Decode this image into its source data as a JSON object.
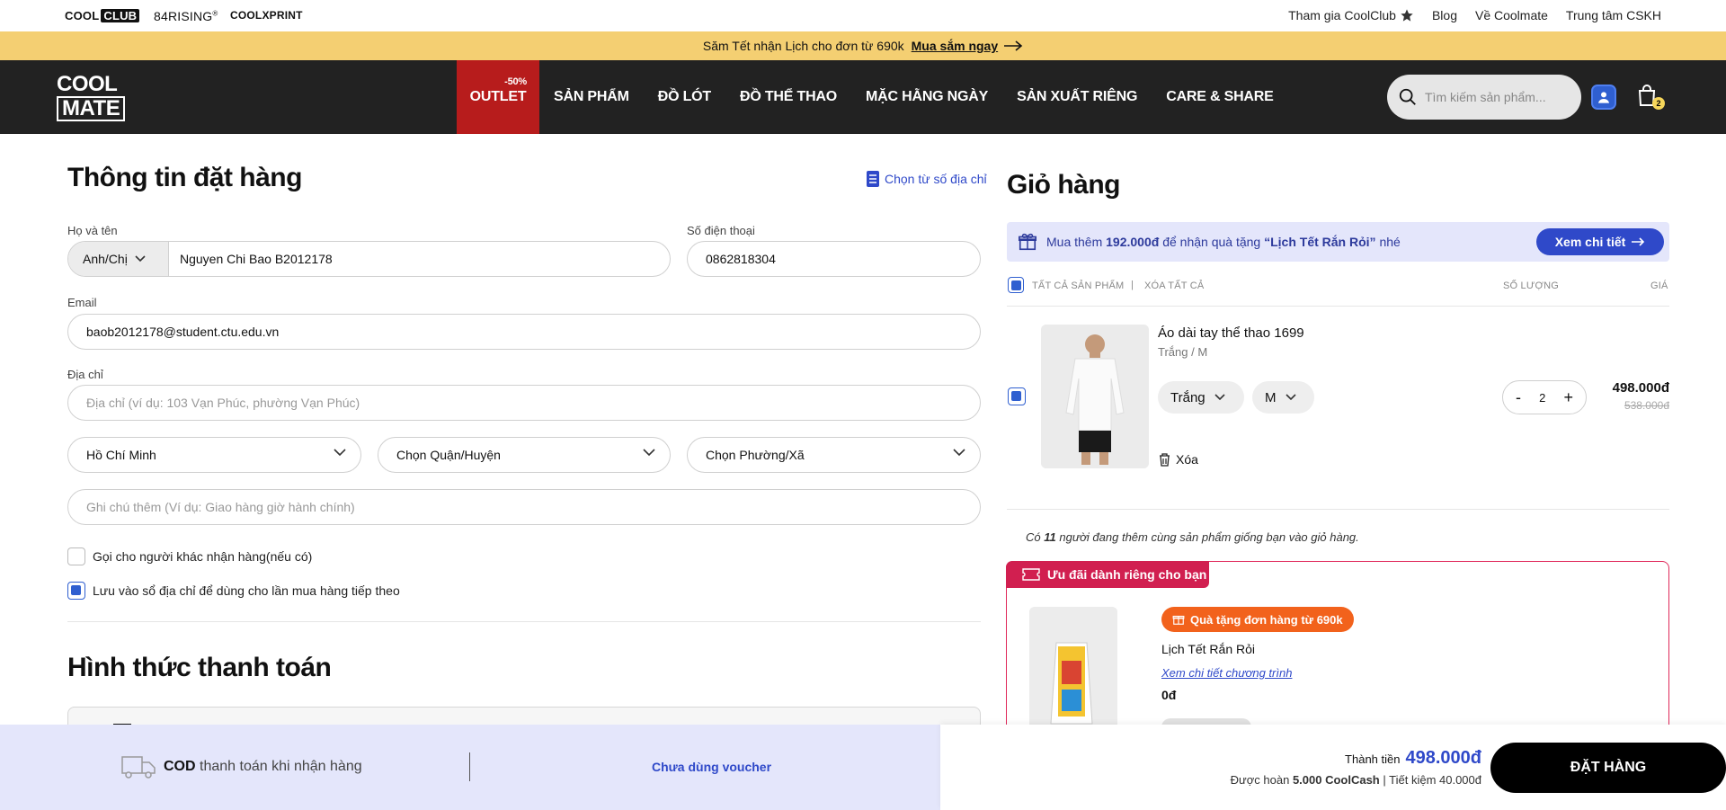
{
  "utility_bar": {
    "brands": [
      "COOL",
      "CLUB",
      "84RISING",
      "®",
      "COOLXPRINT"
    ],
    "links": [
      "Tham gia CoolClub",
      "Blog",
      "Về Coolmate",
      "Trung tâm CSKH"
    ]
  },
  "promo": {
    "text": "Săm Tết nhận Lịch cho đơn từ 690k",
    "cta": "Mua sắm ngay"
  },
  "header": {
    "logo_line1": "COOL",
    "logo_line2": "MATE",
    "menu": [
      {
        "label": "OUTLET",
        "badge": "-50%"
      },
      {
        "label": "SẢN PHẨM"
      },
      {
        "label": "ĐỒ LÓT"
      },
      {
        "label": "ĐỒ THỂ THAO"
      },
      {
        "label": "MẶC HẰNG NGÀY"
      },
      {
        "label": "SẢN XUẤT RIÊNG"
      },
      {
        "label": "CARE & SHARE"
      }
    ],
    "search_placeholder": "Tìm kiếm sản phẩm...",
    "cart_count": "2"
  },
  "order_form": {
    "title": "Thông tin đặt hàng",
    "address_book_link": "Chọn từ số địa chỉ",
    "name_label": "Họ và tên",
    "salutation": "Anh/Chị",
    "name_value": "Nguyen Chi Bao B2012178",
    "phone_label": "Số điện thoại",
    "phone_value": "0862818304",
    "email_label": "Email",
    "email_value": "baob2012178@student.ctu.edu.vn",
    "address_label": "Địa chỉ",
    "address_placeholder": "Địa chỉ (ví dụ: 103 Vạn Phúc, phường Vạn Phúc)",
    "province": "Hồ Chí Minh",
    "district": "Chọn Quận/Huyện",
    "ward": "Chọn Phường/Xã",
    "note_placeholder": "Ghi chú thêm (Ví dụ: Giao hàng giờ hành chính)",
    "call_other_label": "Gọi cho người khác nhận hàng(nếu có)",
    "save_address_label": "Lưu vào sổ địa chỉ để dùng cho lần mua hàng tiếp theo"
  },
  "payment": {
    "title": "Hình thức thanh toán"
  },
  "cart": {
    "title": "Giỏ hàng",
    "gift_prefix": "Mua thêm",
    "gift_amount": "192.000đ",
    "gift_middle": "để nhận quà tặng",
    "gift_name": "“Lịch Tết Rắn Rỏi”",
    "gift_suffix": "nhé",
    "gift_button": "Xem chi tiết",
    "col_all": "TẤT CẢ SẢN PHẨM",
    "col_separator": "|",
    "col_clear": "XÓA TẤT CẢ",
    "col_qty": "SỐ LƯỢNG",
    "col_price": "GIÁ",
    "item": {
      "name": "Áo dài tay thể thao 1699",
      "variant": "Trắng / M",
      "color": "Trắng",
      "size": "M",
      "remove": "Xóa",
      "qty": "2",
      "minus": "-",
      "plus": "+",
      "price": "498.000đ",
      "old_price": "538.000đ"
    },
    "social_prefix": "Có",
    "social_count": "11",
    "social_suffix": "người đang thêm cùng sản phẩm giống bạn vào giỏ hàng.",
    "offer_tag": "Ưu đãi dành riêng cho bạn",
    "offer_gift_pill": "Quà tặng đơn hàng từ 690k",
    "offer_gift_name": "Lịch Tết Rắn Rỏi",
    "offer_link": "Xem chi tiết chương trình",
    "offer_price": "0đ"
  },
  "checkout_bar": {
    "cod_bold": "COD",
    "cod_rest": "thanh toán khi nhận hàng",
    "voucher": "Chưa dùng voucher",
    "total_label": "Thành tiền",
    "total_value": "498.000đ",
    "cashback_prefix": "Được hoàn",
    "cashback_value": "5.000 CoolCash",
    "savings": "| Tiết kiệm 40.000đ",
    "order_button": "ĐẶT HÀNG"
  },
  "colors": {
    "accent": "#2f49c9",
    "nav_bg": "#222222",
    "promo_bg": "#f4cf72",
    "outlet_bg": "#b71c1c",
    "offer_red": "#d11f50",
    "gift_orange": "#f2621c"
  }
}
